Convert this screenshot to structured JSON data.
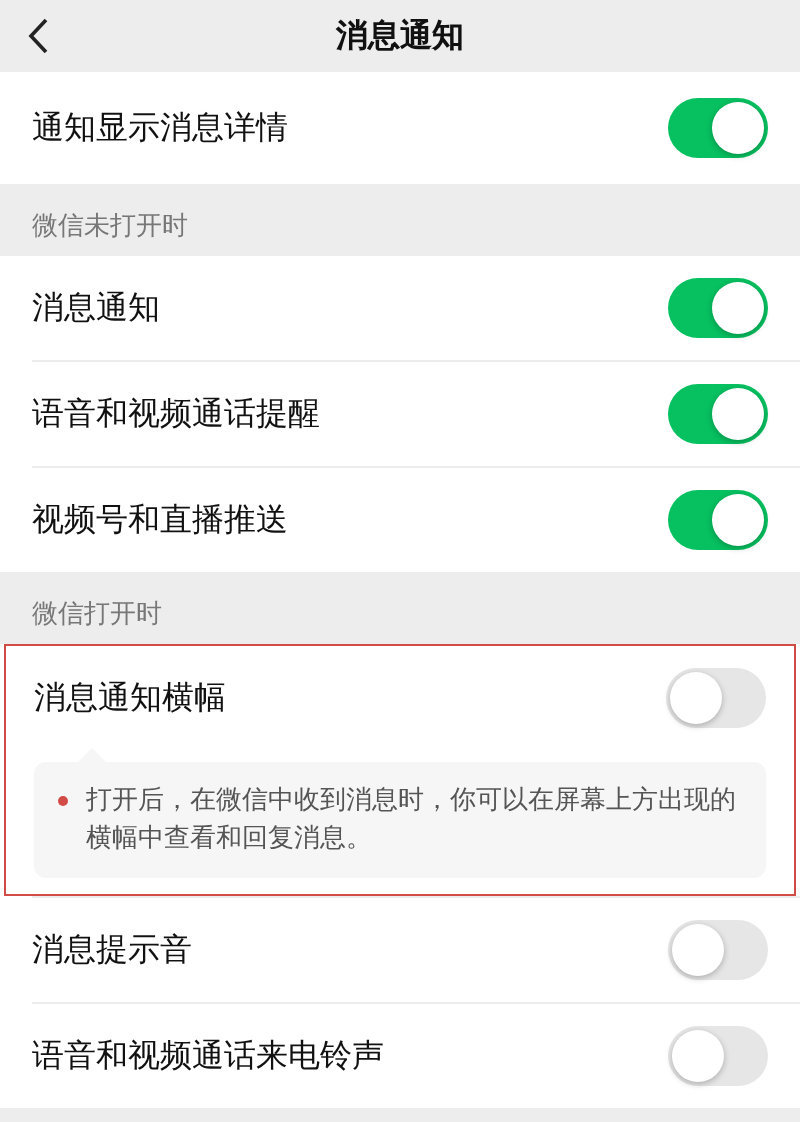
{
  "header": {
    "title": "消息通知"
  },
  "sections": [
    {
      "rows": [
        {
          "label": "通知显示消息详情",
          "on": true,
          "highlighted": false
        }
      ]
    },
    {
      "header": "微信未打开时",
      "rows": [
        {
          "label": "消息通知",
          "on": true,
          "highlighted": false
        },
        {
          "label": "语音和视频通话提醒",
          "on": true,
          "highlighted": false
        },
        {
          "label": "视频号和直播推送",
          "on": true,
          "highlighted": false
        }
      ]
    },
    {
      "header": "微信打开时",
      "rows": [
        {
          "label": "消息通知横幅",
          "on": false,
          "highlighted": true,
          "tip": "打开后，在微信中收到消息时，你可以在屏幕上方出现的横幅中查看和回复消息。"
        },
        {
          "label": "消息提示音",
          "on": false,
          "highlighted": false
        },
        {
          "label": "语音和视频通话来电铃声",
          "on": false,
          "highlighted": false
        }
      ]
    }
  ]
}
